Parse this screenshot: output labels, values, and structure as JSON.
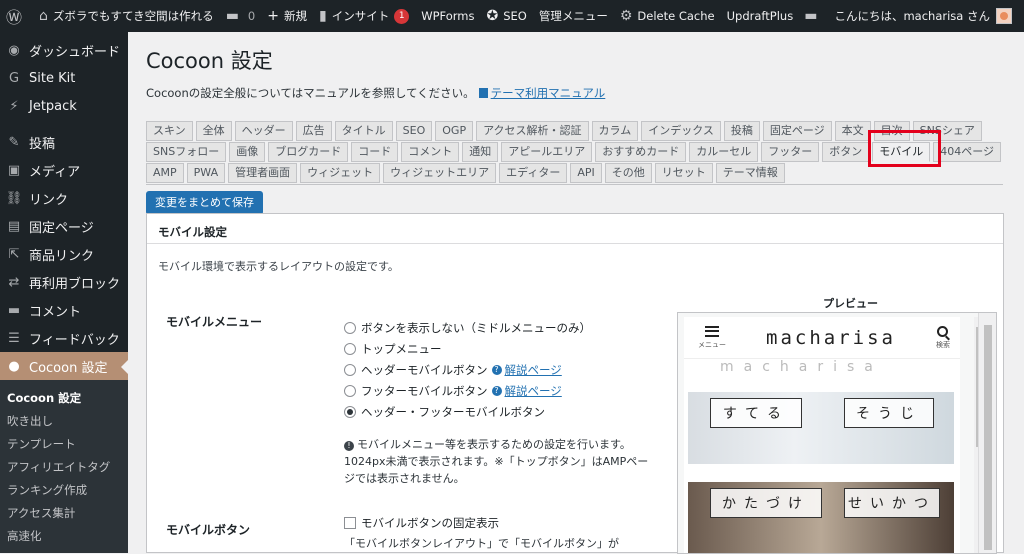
{
  "adminbar": {
    "site_name": "ズボラでもすてき空間は作れる",
    "comments_count": "0",
    "new_label": "新規",
    "insight_label": "インサイト",
    "insight_count": "1",
    "wpforms_label": "WPForms",
    "seo_label": "SEO",
    "admin_menu_label": "管理メニュー",
    "delete_cache_label": "Delete Cache",
    "updraft_label": "UpdraftPlus",
    "greeting": "こんにちは、macharisa さん"
  },
  "sidebar": {
    "items": [
      {
        "label": "ダッシュボード",
        "icon": "◉"
      },
      {
        "label": "Site Kit",
        "icon": "G"
      },
      {
        "label": "Jetpack",
        "icon": "⚡"
      },
      {
        "label": "投稿",
        "icon": "✎"
      },
      {
        "label": "メディア",
        "icon": "▣"
      },
      {
        "label": "リンク",
        "icon": "⛓"
      },
      {
        "label": "固定ページ",
        "icon": "▤"
      },
      {
        "label": "商品リンク",
        "icon": "⇱"
      },
      {
        "label": "再利用ブロック",
        "icon": "⇄"
      },
      {
        "label": "コメント",
        "icon": "▬"
      },
      {
        "label": "フィードバック",
        "icon": "☰"
      }
    ],
    "current": {
      "label": "Cocoon 設定",
      "icon": "●"
    },
    "submenu": [
      "Cocoon 設定",
      "吹き出し",
      "テンプレート",
      "アフィリエイトタグ",
      "ランキング作成",
      "アクセス集計",
      "高速化"
    ]
  },
  "main": {
    "title": "Cocoon 設定",
    "intro_text": "Cocoonの設定全般についてはマニュアルを参照してください。",
    "manual_link": "テーマ利用マニュアル",
    "tabs_row1": [
      "スキン",
      "全体",
      "ヘッダー",
      "広告",
      "タイトル",
      "SEO",
      "OGP",
      "アクセス解析・認証",
      "カラム",
      "インデックス",
      "投稿",
      "固定ページ",
      "本文",
      "目次",
      "SNSシェア"
    ],
    "tabs_row2": [
      "SNSフォロー",
      "画像",
      "ブログカード",
      "コード",
      "コメント",
      "通知",
      "アピールエリア",
      "おすすめカード",
      "カルーセル",
      "フッター",
      "ボタン",
      "モバイル",
      "404ページ"
    ],
    "tabs_row3": [
      "AMP",
      "PWA",
      "管理者画面",
      "ウィジェット",
      "ウィジェットエリア",
      "エディター",
      "API",
      "その他",
      "リセット",
      "テーマ情報"
    ],
    "active_tab": "モバイル",
    "save_button": "変更をまとめて保存",
    "panel_title": "モバイル設定",
    "panel_desc": "モバイル環境で表示するレイアウトの設定です。",
    "mobile_menu_label": "モバイルメニュー",
    "radios": [
      {
        "label": "ボタンを表示しない（ミドルメニューのみ）",
        "checked": false,
        "link": ""
      },
      {
        "label": "トップメニュー",
        "checked": false,
        "link": ""
      },
      {
        "label": "ヘッダーモバイルボタン",
        "checked": false,
        "link": "解説ページ"
      },
      {
        "label": "フッターモバイルボタン",
        "checked": false,
        "link": "解説ページ"
      },
      {
        "label": "ヘッダー・フッターモバイルボタン",
        "checked": true,
        "link": ""
      }
    ],
    "note": "モバイルメニュー等を表示するための設定を行います。1024px未満で表示されます。※「トップボタン」はAMPページでは表示されません。",
    "mobile_button_label": "モバイルボタン",
    "fixed_display_label": "モバイルボタンの固定表示",
    "cut_line": "「モバイルボタンレイアウト」で「モバイルボタン」が",
    "preview_label": "プレビュー",
    "preview": {
      "logo": "macharisa",
      "menu_caption": "メニュー",
      "search_caption": "検索",
      "card1_left": "すてる",
      "card1_right": "そうじ",
      "card2_left": "かたづけ",
      "card2_right": "せいかつ",
      "faded_text": "macharisa"
    }
  }
}
